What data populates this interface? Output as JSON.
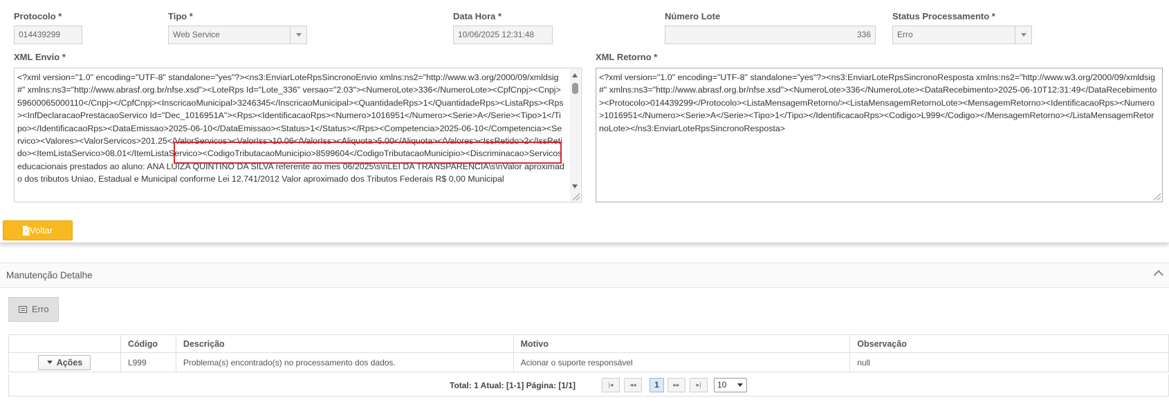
{
  "form": {
    "protocolo": {
      "label": "Protocolo *",
      "value": "014439299"
    },
    "tipo": {
      "label": "Tipo *",
      "value": "Web Service"
    },
    "data_hora": {
      "label": "Data Hora *",
      "value": "10/06/2025 12:31:48"
    },
    "numero_lote": {
      "label": "Número Lote",
      "value": "336"
    },
    "status": {
      "label": "Status Processamento *",
      "value": "Erro"
    },
    "xml_envio": {
      "label": "XML Envio *",
      "value": "<?xml version=\"1.0\" encoding=\"UTF-8\" standalone=\"yes\"?><ns3:EnviarLoteRpsSincronoEnvio xmlns:ns2=\"http://www.w3.org/2000/09/xmldsig#\" xmlns:ns3=\"http://www.abrasf.org.br/nfse.xsd\"><LoteRps Id=\"Lote_336\" versao=\"2.03\"><NumeroLote>336</NumeroLote><CpfCnpj><Cnpj>59600065000110</Cnpj></CpfCnpj><InscricaoMunicipal>3246345</InscricaoMunicipal><QuantidadeRps>1</QuantidadeRps><ListaRps><Rps><InfDeclaracaoPrestacaoServico Id=\"Dec_1016951A\"><Rps><IdentificacaoRps><Numero>1016951</Numero><Serie>A</Serie><Tipo>1</Tipo></IdentificacaoRps><DataEmissao>2025-06-10</DataEmissao><Status>1</Status></Rps><Competencia>2025-06-10</Competencia><Servico><Valores><ValorServicos>201.25</ValorServicos><ValorIss>10.06</ValorIss><Aliquota>5.00</Aliquota></Valores><IssRetido>2</IssRetido><ItemListaServico>08.01</ItemListaServico><CodigoTributacaoMunicipio>8599604</CodigoTributacaoMunicipio><Discriminacao>Servicos educacionais prestados ao aluno: ANA LUIZA QUINTINO DA SILVA referente ao mes 06/2025\\s\\nLEI DA TRANSPARENCIA\\s\\nValor aproximado dos tributos Uniao, Estadual e Municipal conforme Lei 12.741/2012 Valor aproximado dos Tributos Federais R$ 0,00 Municipal"
    },
    "xml_retorno": {
      "label": "XML Retorno *",
      "value": "<?xml version=\"1.0\" encoding=\"UTF-8\" standalone=\"yes\"?><ns3:EnviarLoteRpsSincronoResposta xmlns:ns2=\"http://www.w3.org/2000/09/xmldsig#\" xmlns:ns3=\"http://www.abrasf.org.br/nfse.xsd\"><NumeroLote>336</NumeroLote><DataRecebimento>2025-06-10T12:31:49</DataRecebimento><Protocolo>014439299</Protocolo><ListaMensagemRetorno/><ListaMensagemRetornoLote><MensagemRetorno><IdentificacaoRps><Numero>1016951</Numero><Serie>A</Serie><Tipo>1</Tipo></IdentificacaoRps><Codigo>L999</Codigo></MensagemRetorno></ListaMensagemRetornoLote></ns3:EnviarLoteRpsSincronoResposta>"
    },
    "voltar_label": "Voltar"
  },
  "detail": {
    "title": "Manutenção Detalhe",
    "erro_tab_label": "Erro",
    "columns": [
      "",
      "Código",
      "Descrição",
      "Motivo",
      "Observação"
    ],
    "rows": [
      {
        "acoes_label": "Ações",
        "codigo": "L999",
        "descricao": "Problema(s) encontrado(s) no processamento dos dados.",
        "motivo": "Acionar o suporte responsável",
        "observacao": "null"
      }
    ],
    "pager": {
      "summary": "Total: 1 Atual: [1-1] Página: [1/1]",
      "current_page": "1",
      "page_size": "10"
    }
  },
  "colors": {
    "primary_button": "#f8b81f",
    "highlight_box": "#d9262c",
    "active_page": "#dbe8f5"
  },
  "icons": {
    "voltar": "door-exit-icon",
    "erro_tab": "list-icon",
    "acoes": "caret-down-icon",
    "collapse": "chevron-up-icon"
  }
}
